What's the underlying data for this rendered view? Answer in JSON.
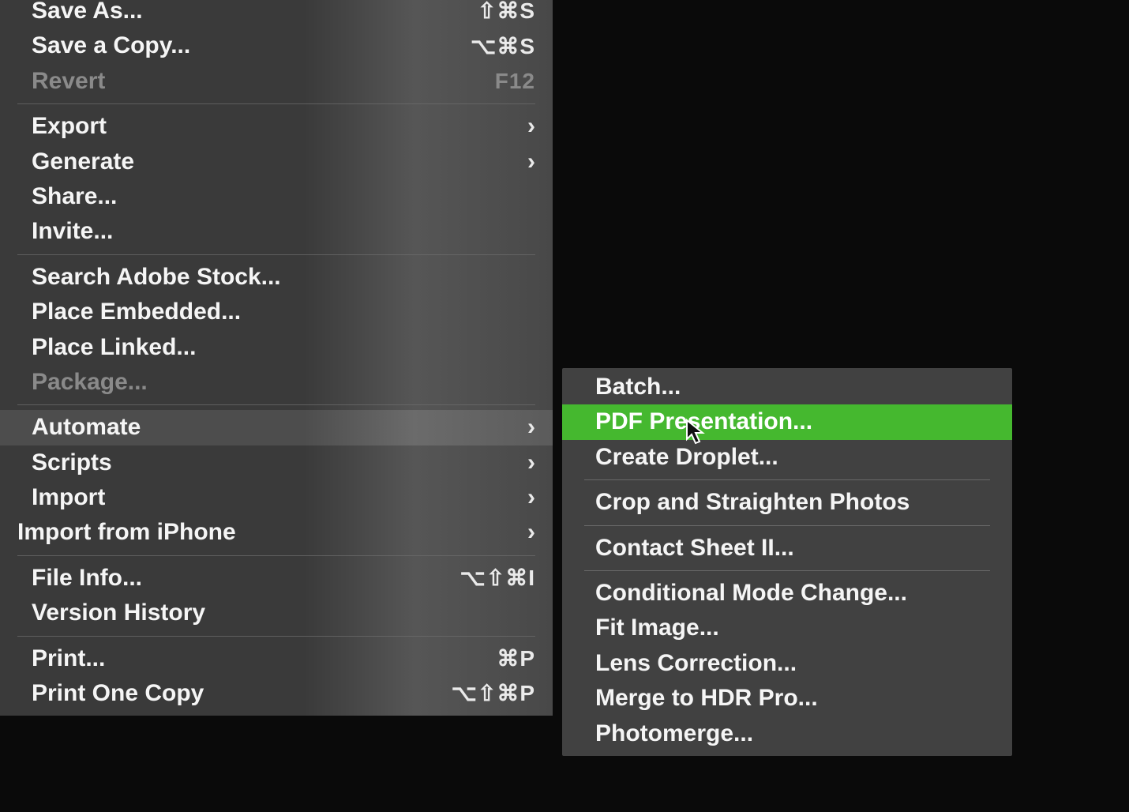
{
  "mainMenu": {
    "items": [
      {
        "label": "Save As...",
        "shortcut": "⇧⌘S",
        "hasSubmenu": false,
        "disabled": false
      },
      {
        "label": "Save a Copy...",
        "shortcut": "⌥⌘S",
        "hasSubmenu": false,
        "disabled": false
      },
      {
        "label": "Revert",
        "shortcut": "F12",
        "hasSubmenu": false,
        "disabled": true
      },
      {
        "separator": true
      },
      {
        "label": "Export",
        "shortcut": "",
        "hasSubmenu": true,
        "disabled": false
      },
      {
        "label": "Generate",
        "shortcut": "",
        "hasSubmenu": true,
        "disabled": false
      },
      {
        "label": "Share...",
        "shortcut": "",
        "hasSubmenu": false,
        "disabled": false
      },
      {
        "label": "Invite...",
        "shortcut": "",
        "hasSubmenu": false,
        "disabled": false
      },
      {
        "separator": true
      },
      {
        "label": "Search Adobe Stock...",
        "shortcut": "",
        "hasSubmenu": false,
        "disabled": false
      },
      {
        "label": "Place Embedded...",
        "shortcut": "",
        "hasSubmenu": false,
        "disabled": false
      },
      {
        "label": "Place Linked...",
        "shortcut": "",
        "hasSubmenu": false,
        "disabled": false
      },
      {
        "label": "Package...",
        "shortcut": "",
        "hasSubmenu": false,
        "disabled": true
      },
      {
        "separator": true
      },
      {
        "label": "Automate",
        "shortcut": "",
        "hasSubmenu": true,
        "disabled": false,
        "highlighted": true
      },
      {
        "label": "Scripts",
        "shortcut": "",
        "hasSubmenu": true,
        "disabled": false
      },
      {
        "label": "Import",
        "shortcut": "",
        "hasSubmenu": true,
        "disabled": false
      },
      {
        "label": "Import from iPhone",
        "shortcut": "",
        "hasSubmenu": true,
        "disabled": false,
        "tightLeft": true
      },
      {
        "separator": true
      },
      {
        "label": "File Info...",
        "shortcut": "⌥⇧⌘I",
        "hasSubmenu": false,
        "disabled": false
      },
      {
        "label": "Version History",
        "shortcut": "",
        "hasSubmenu": false,
        "disabled": false
      },
      {
        "separator": true
      },
      {
        "label": "Print...",
        "shortcut": "⌘P",
        "hasSubmenu": false,
        "disabled": false
      },
      {
        "label": "Print One Copy",
        "shortcut": "⌥⇧⌘P",
        "hasSubmenu": false,
        "disabled": false
      }
    ]
  },
  "submenu": {
    "items": [
      {
        "label": "Batch...",
        "highlighted": false
      },
      {
        "label": "PDF Presentation...",
        "highlighted": true
      },
      {
        "label": "Create Droplet...",
        "highlighted": false
      },
      {
        "separator": true
      },
      {
        "label": "Crop and Straighten Photos",
        "highlighted": false
      },
      {
        "separator": true
      },
      {
        "label": "Contact Sheet II...",
        "highlighted": false
      },
      {
        "separator": true
      },
      {
        "label": "Conditional Mode Change...",
        "highlighted": false
      },
      {
        "label": "Fit Image...",
        "highlighted": false
      },
      {
        "label": "Lens Correction...",
        "highlighted": false
      },
      {
        "label": "Merge to HDR Pro...",
        "highlighted": false
      },
      {
        "label": "Photomerge...",
        "highlighted": false
      }
    ]
  }
}
